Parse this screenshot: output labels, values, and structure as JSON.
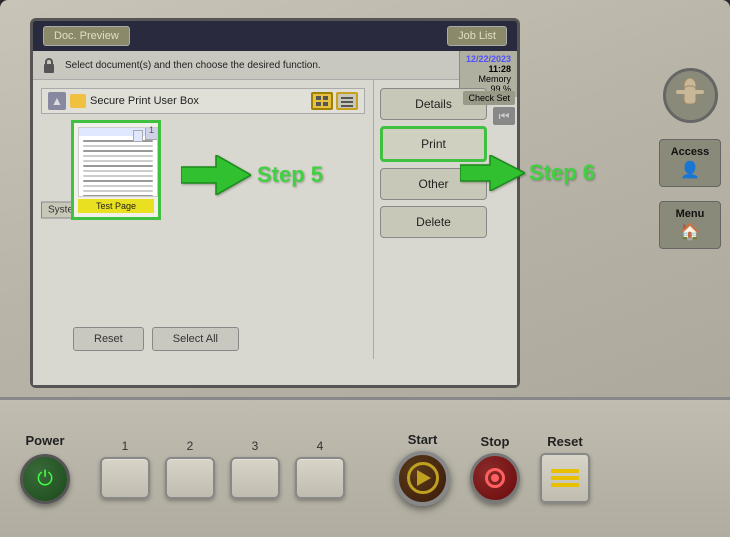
{
  "screen": {
    "topbar": {
      "doc_preview": "Doc. Preview",
      "job_list": "Job List"
    },
    "info": {
      "message": "Select document(s) and then choose the desired function.",
      "datetime": "12/22/2023",
      "time": "11:28",
      "memory": "Memory",
      "memory_pct": "99 %",
      "check_set": "Check Set"
    },
    "folder_bar": {
      "title": "Secure Print User Box"
    },
    "document": {
      "name": "Test Page",
      "count": "1"
    },
    "system_label": "System",
    "buttons": {
      "details": "Details",
      "print": "Print",
      "other": "Other",
      "delete": "Delete",
      "reset": "Reset",
      "select_all": "Select All"
    }
  },
  "annotations": {
    "step5": "Step 5",
    "step6": "Step 6"
  },
  "control_panel": {
    "power": "Power",
    "num1": "1",
    "num2": "2",
    "num3": "3",
    "num4": "4",
    "start": "Start",
    "stop": "Stop",
    "reset": "Reset"
  },
  "side_panel": {
    "access": "Access",
    "menu": "Menu"
  },
  "colors": {
    "accent_green": "#40c040",
    "annotation_green": "#40d040",
    "start_gold": "#c0a020",
    "stop_red": "#ff6060",
    "doc_yellow": "#e8e020",
    "highlight_yellow": "#e8c040"
  }
}
